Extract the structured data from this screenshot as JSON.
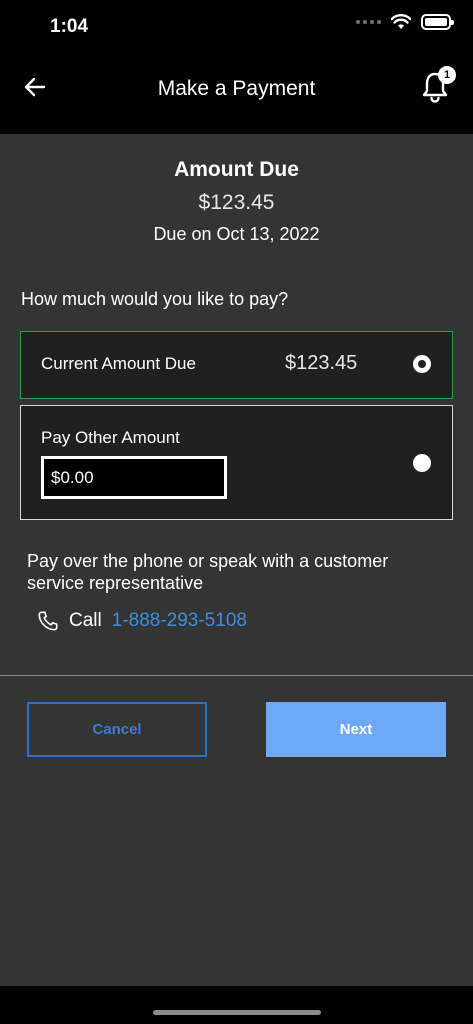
{
  "status_bar": {
    "time": "1:04"
  },
  "header": {
    "title": "Make a Payment",
    "notification_count": "1"
  },
  "summary": {
    "label": "Amount Due",
    "amount": "$123.45",
    "due_date": "Due on Oct 13, 2022"
  },
  "question": "How much would you like to pay?",
  "options": {
    "current": {
      "label": "Current Amount Due",
      "amount": "$123.45",
      "selected": true
    },
    "other": {
      "label": "Pay Other Amount",
      "input_value": "$0.00",
      "selected": false
    }
  },
  "phone": {
    "text": "Pay over the phone or speak with a customer service representative",
    "call_label": "Call",
    "number": "1-888-293-5108"
  },
  "buttons": {
    "cancel": "Cancel",
    "next": "Next"
  },
  "colors": {
    "selected_border": "#25a244",
    "link": "#3d8fe0",
    "cancel_border": "#2f6fbf",
    "next_bg": "#6fa8f5"
  }
}
